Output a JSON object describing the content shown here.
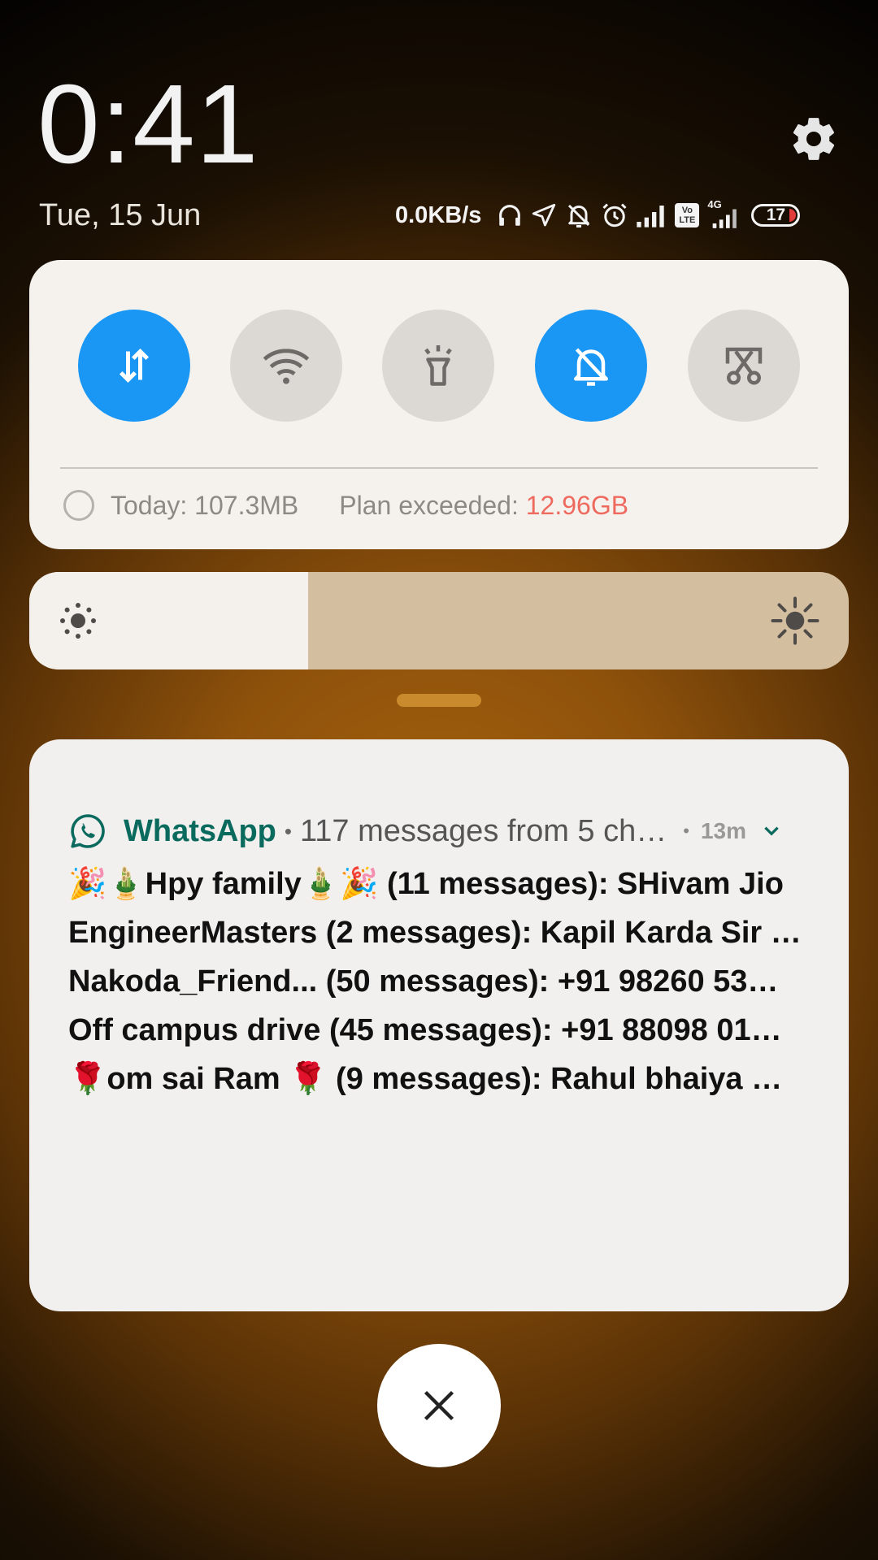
{
  "status": {
    "time": "0:41",
    "date": "Tue, 15 Jun",
    "net_speed": "0.0KB/s",
    "volte_label": "Vo\nLTE",
    "network_type": "4G",
    "battery_level": "17",
    "icons": [
      "headset-icon",
      "location-icon",
      "muted-bell-icon",
      "alarm-icon",
      "signal-icon",
      "volte-icon",
      "signal-4g-icon",
      "battery-icon"
    ]
  },
  "quick_settings": {
    "toggles": [
      {
        "name": "mobile-data",
        "icon": "data-transfer-icon",
        "on": true
      },
      {
        "name": "wifi",
        "icon": "wifi-icon",
        "on": false
      },
      {
        "name": "flashlight",
        "icon": "flashlight-icon",
        "on": false
      },
      {
        "name": "mute",
        "icon": "muted-bell-icon",
        "on": true
      },
      {
        "name": "screenshot",
        "icon": "scissors-icon",
        "on": false
      }
    ],
    "today_label": "Today: 107.3MB",
    "plan_label": "Plan exceeded: ",
    "plan_value": "12.96GB"
  },
  "brightness": {
    "level": 0.34
  },
  "notification": {
    "app_name": "WhatsApp",
    "summary": "117 messages from 5 ch…",
    "time": "13m",
    "lines": [
      "🎉🎍Hpy family🎍🎉 (11 messages): SHivam Jio",
      "EngineerMasters (2 messages): Kapil Karda Sir …",
      "Nakoda_Friend... (50 messages): +91 98260 53…",
      "Off campus drive (45 messages): +91 88098 01…",
      "🌹om  sai  Ram  🌹 (9 messages): Rahul bhaiya …"
    ]
  },
  "colors": {
    "toggle_on": "#1a97f5",
    "toggle_off": "#dcd9d5",
    "whatsapp_green": "#0a6a5e",
    "exceeded_red": "#ee6a5e"
  }
}
